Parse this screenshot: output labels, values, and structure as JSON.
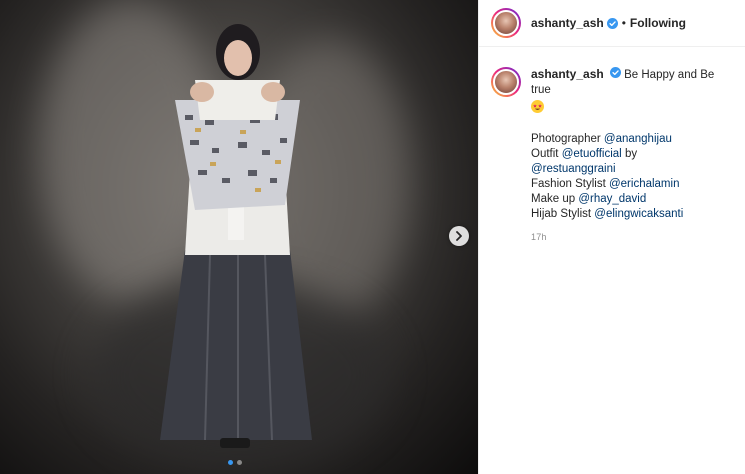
{
  "header": {
    "username": "ashanty_ash",
    "separator": "•",
    "follow_label": "Following"
  },
  "caption": {
    "username": "ashanty_ash",
    "text": "Be Happy and Be true",
    "emoji": "star-struck",
    "credits": [
      {
        "label": "Photographer",
        "mentions": [
          "@ananghijau"
        ]
      },
      {
        "label": "Outfit",
        "mentions": [
          "@etuofficial"
        ],
        "suffix": "by"
      },
      {
        "label": "",
        "mentions": [
          "@restuanggraini"
        ]
      },
      {
        "label": "Fashion Stylist",
        "mentions": [
          "@erichalamin"
        ]
      },
      {
        "label": "Make up",
        "mentions": [
          "@rhay_david"
        ]
      },
      {
        "label": "Hijab Stylist",
        "mentions": [
          "@elingwicaksanti"
        ]
      }
    ],
    "time": "17h"
  },
  "carousel": {
    "current": 1,
    "total": 2
  },
  "colors": {
    "link": "#00376b",
    "verified": "#3897f0",
    "active_dot": "#3897f0"
  }
}
